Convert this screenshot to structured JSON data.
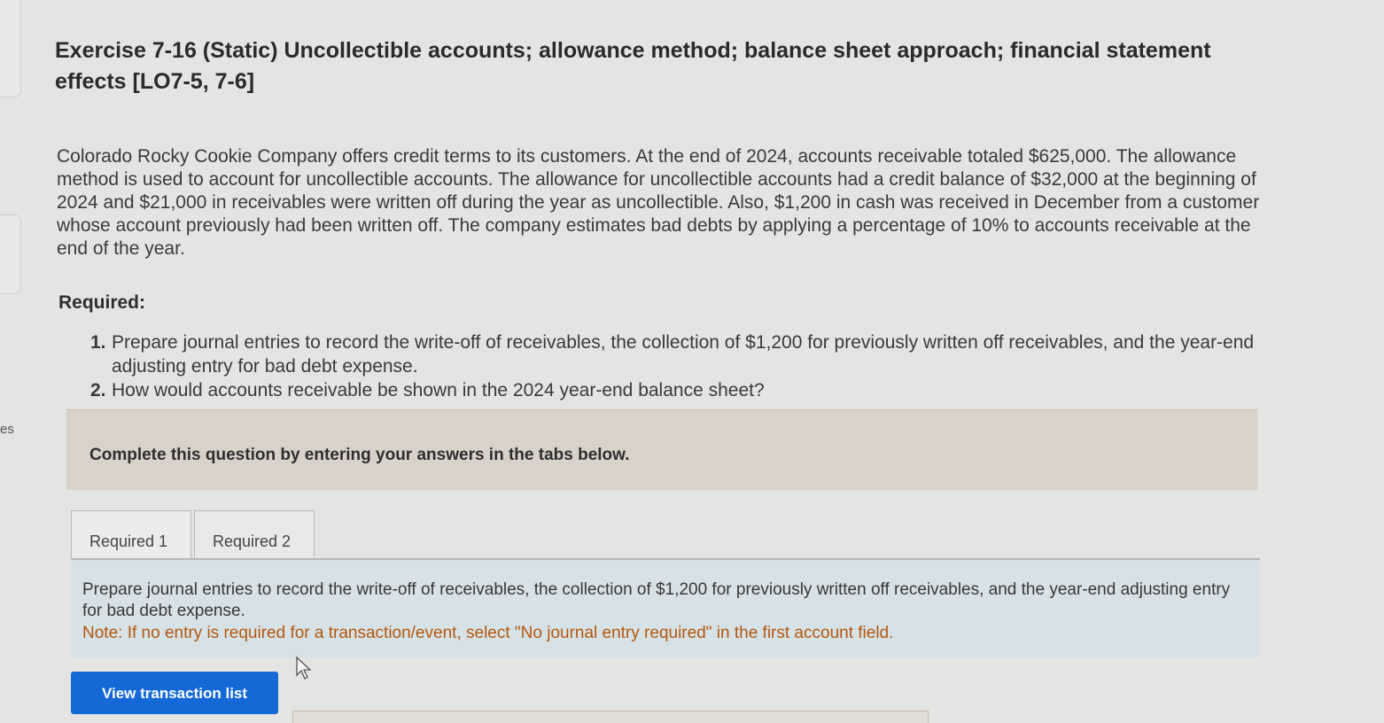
{
  "side": {
    "text": "es"
  },
  "exercise": {
    "title": "Exercise 7-16 (Static) Uncollectible accounts; allowance method; balance sheet approach; financial statement effects [LO7-5, 7-6]",
    "intro": "Colorado Rocky Cookie Company offers credit terms to its customers. At the end of 2024, accounts receivable totaled $625,000. The allowance method is used to account for uncollectible accounts. The allowance for uncollectible accounts had a credit balance of $32,000 at the beginning of 2024 and $21,000 in receivables were written off during the year as uncollectible. Also, $1,200 in cash was received in December from a customer whose account previously had been written off. The company estimates bad debts by applying a percentage of 10% to accounts receivable at the end of the year.",
    "required_heading": "Required:",
    "requirements": [
      {
        "num": "1.",
        "text": "Prepare journal entries to record the write-off of receivables, the collection of $1,200 for previously written off receivables, and the year-end adjusting entry for bad debt expense."
      },
      {
        "num": "2.",
        "text": "How would accounts receivable be shown in the 2024 year-end balance sheet?"
      }
    ]
  },
  "banner": {
    "text": "Complete this question by entering your answers in the tabs below."
  },
  "tabs": [
    {
      "label": "Required 1",
      "active": true
    },
    {
      "label": "Required 2",
      "active": false
    }
  ],
  "panel": {
    "instructions": "Prepare journal entries to record the write-off of receivables, the collection of $1,200 for previously written off receivables, and the year-end adjusting entry for bad debt expense.",
    "note": "Note: If no entry is required for a transaction/event, select \"No journal entry required\" in the first account field."
  },
  "buttons": {
    "view_transaction_list": "View transaction list"
  },
  "colors": {
    "button_blue": "#1469d6",
    "note_orange": "#b5570f",
    "banner_tan": "#d8d2c8",
    "panel_blue": "#d6e2e5"
  },
  "icons": {
    "cursor": "mouse-pointer-icon"
  }
}
